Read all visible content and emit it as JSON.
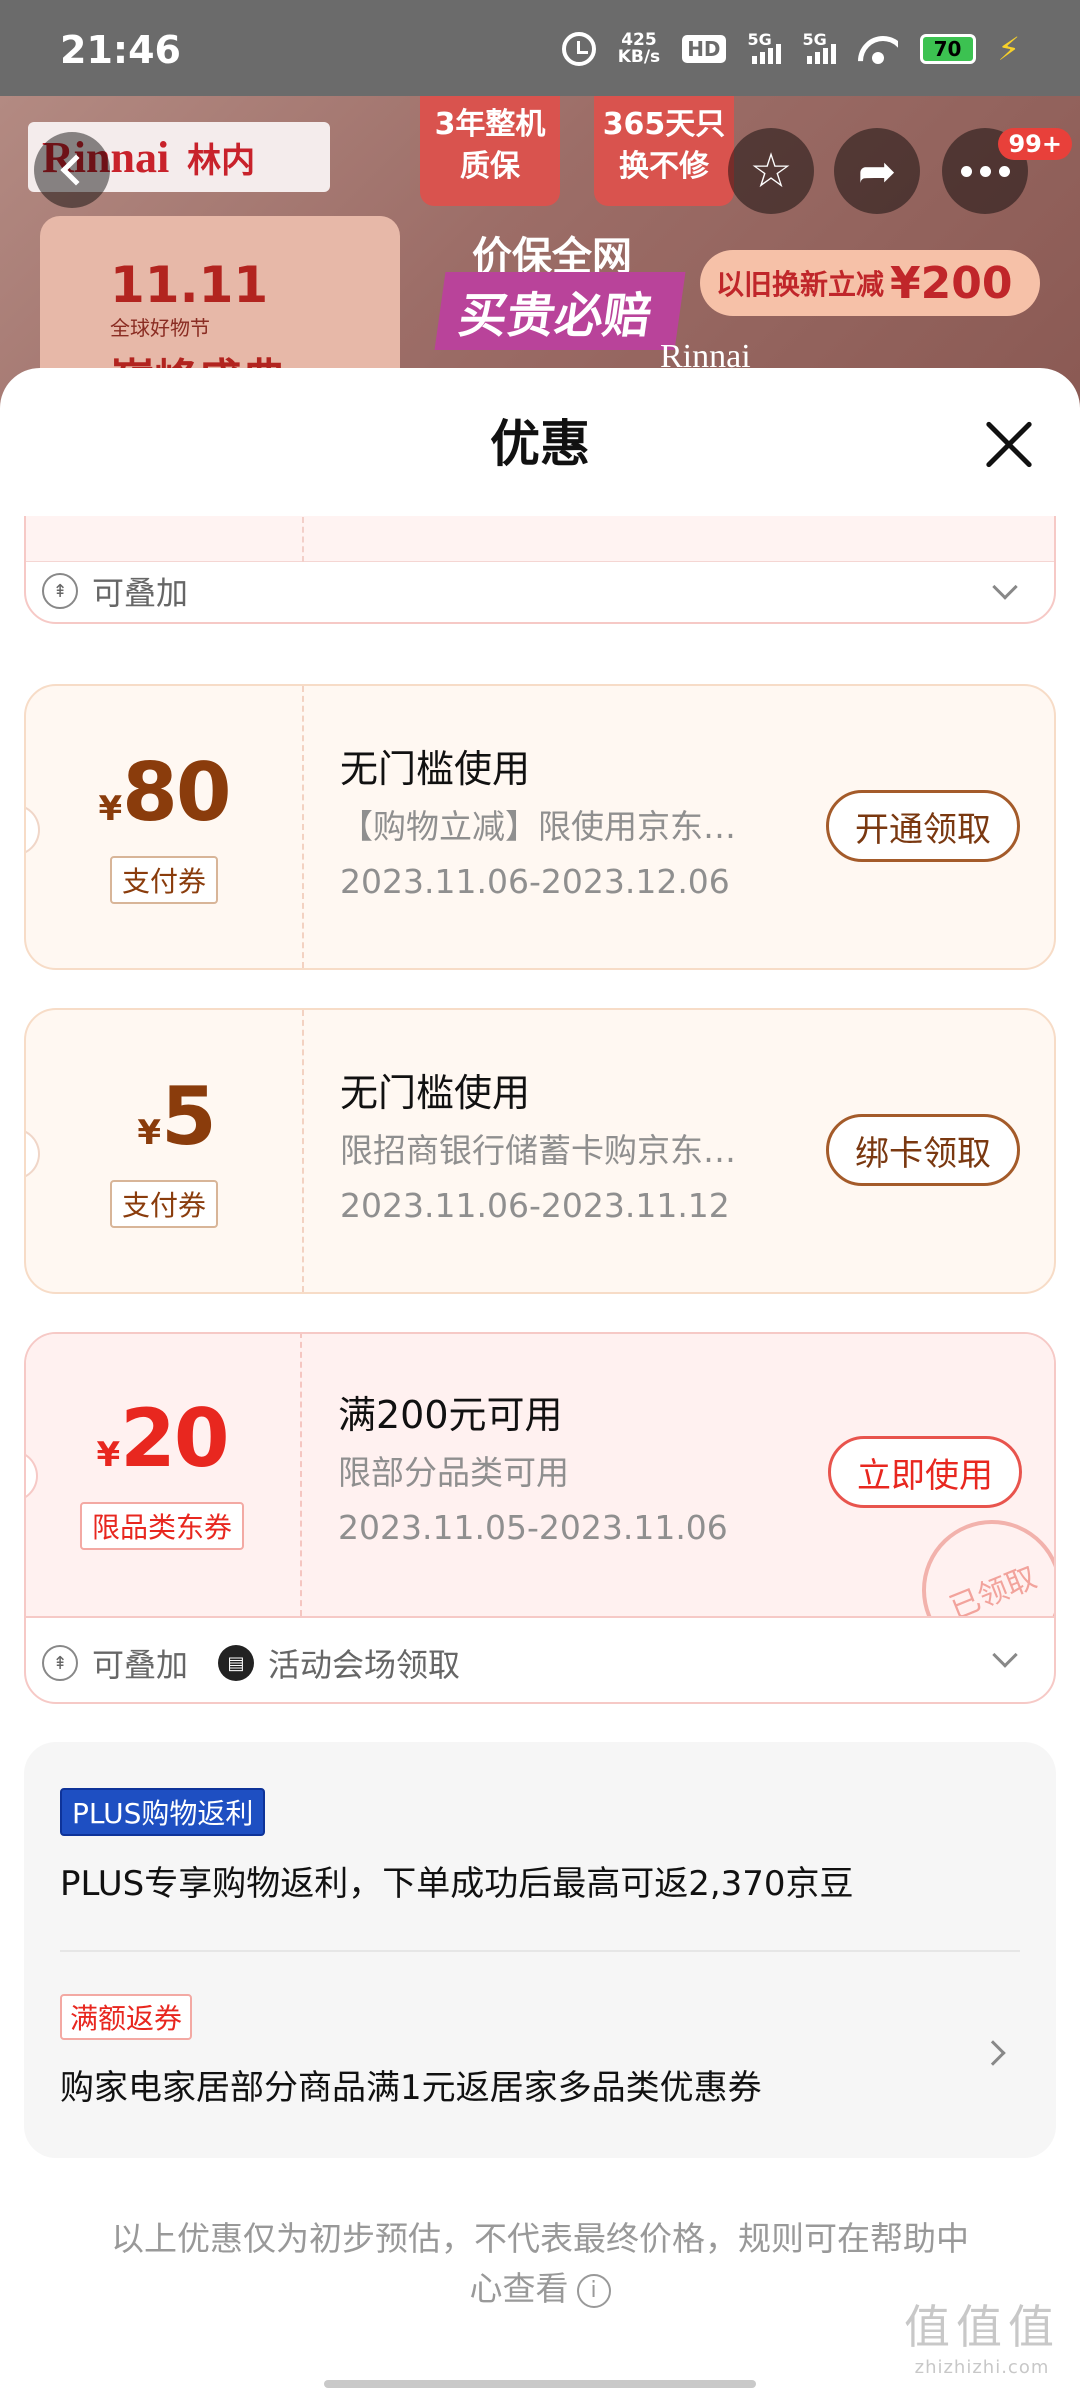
{
  "status_bar": {
    "time": "21:46",
    "net_speed_value": "425",
    "net_speed_unit": "KB/s",
    "hd_label": "HD",
    "sim1_label": "5G",
    "sim2_label": "5G",
    "battery": "70"
  },
  "product_header": {
    "brand_en": "Rinnai",
    "brand_cn": "林内",
    "tag_warranty": "3年整机质保",
    "tag_replace": "365天只换不修",
    "event_line1": "11.11",
    "event_line2": "全球好物节",
    "event_line3": "巅峰盛典",
    "price_protect": "价保全网",
    "compensate": "买贵必赔",
    "trade_in": "以旧换新立减",
    "trade_in_amount": "¥200",
    "brand_small": "Rinnai",
    "more_badge": "99+"
  },
  "sheet": {
    "title": "优惠",
    "stackable": "可叠加",
    "venue_claim": "活动会场领取"
  },
  "coupons": [
    {
      "currency": "¥",
      "amount": "80",
      "type": "支付券",
      "condition": "无门槛使用",
      "description": "【购物立减】限使用京东…",
      "validity": "2023.11.06-2023.12.06",
      "action": "开通领取",
      "style": "beige"
    },
    {
      "currency": "¥",
      "amount": "5",
      "type": "支付券",
      "condition": "无门槛使用",
      "description": "限招商银行储蓄卡购京东…",
      "validity": "2023.11.06-2023.11.12",
      "action": "绑卡领取",
      "style": "beige"
    },
    {
      "currency": "¥",
      "amount": "20",
      "type": "限品类东券",
      "condition": "满200元可用",
      "description": "限部分品类可用",
      "validity": "2023.11.05-2023.11.06",
      "action": "立即使用",
      "stamp": "已领取",
      "style": "pink"
    }
  ],
  "rebates": [
    {
      "tag": "PLUS购物返利",
      "text": "PLUS专享购物返利，下单成功后最高可返2,370京豆"
    },
    {
      "tag": "满额返券",
      "text": "购家电家居部分商品满1元返居家多品类优惠券"
    }
  ],
  "disclaimer": "以上优惠仅为初步预估，不代表最终价格，规则可在帮助中心查看",
  "watermark": {
    "line1": "值值值",
    "line2": "zhizhizhi.com"
  },
  "colors": {
    "accent_red": "#e8271f",
    "coupon_brown": "#8a3c0c",
    "plus_blue": "#1e4fc2"
  }
}
